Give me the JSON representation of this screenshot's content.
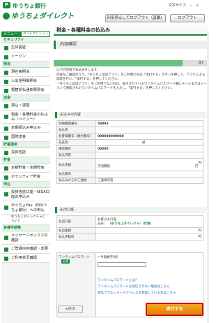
{
  "header": {
    "logo_mark": "P",
    "bank_name": "ゆうちょ銀行",
    "service_name": "ゆうちょダイレクト",
    "text_size_label": "文字サイズ",
    "size_minus": "－",
    "size_plus": "＋",
    "stop_logout_label": "利用停止してログアウト（盗難）",
    "logout_label": "ログアウト"
  },
  "sidebar": {
    "menu_label": "メニュー",
    "top_label": "ダイレクトトップ",
    "sections": [
      {
        "label": "セキュリティ",
        "items": [
          {
            "label": "生体認証"
          },
          {
            "label": "トークン"
          }
        ]
      },
      {
        "label": "照会",
        "items": [
          {
            "label": "現在高照会"
          },
          {
            "label": "入出金明細照会"
          },
          {
            "label": "振替受払通知票照会"
          }
        ]
      },
      {
        "label": "送金",
        "items": [
          {
            "label": "振込・振替"
          },
          {
            "label": "税金・各種料金の払込み（ペイジー）"
          },
          {
            "label": "定期振込み申込み"
          },
          {
            "label": "国際送金"
          }
        ]
      },
      {
        "label": "貯蓄運用",
        "items": [
          {
            "label": "投資信託"
          }
        ]
      },
      {
        "label": "貯金",
        "items": [
          {
            "label": "定額貯金・定期貯金"
          },
          {
            "label": "ボランティア貯金"
          }
        ]
      },
      {
        "label": "申込",
        "items": [
          {
            "label": "投資信託口座・NISA口座の申込み"
          },
          {
            "label": "ゆうちょPay（旧ゆうちょ銀行）への申込"
          }
        ]
      },
      {
        "label": "各種手続等",
        "items": [
          {
            "label": "メッセージボックスの確認"
          },
          {
            "label": "ご登録内容確認・変更"
          },
          {
            "label": "ご利用状況確認"
          }
        ]
      }
    ],
    "note_text": "ゆうちょダイレクト+について"
  },
  "main": {
    "title": "税金・各種料金の払込み",
    "subtitle": "内容確認",
    "step_label": "次7",
    "desc_lines": [
      "以下の内容で払込みをします。",
      "内容をご確認のうえ、「ゆうちょ認証アプリ」をご利用の方は「実行する」ボタンを押して、アプリによる認証を行い、「実行する」を押してください。",
      "「ゆうちょ認証アプリ」をご利用でない方は、表示されているワンタイムパスワード欄にメールまたはトークンで通知されたワンタイムパスワードを入力し、「実行する」を押してください。"
    ],
    "payment_section": "払込みの内容",
    "payment_rows": [
      {
        "label": "収納機関番号",
        "value": "58093"
      },
      {
        "label": "払込先",
        "value": ""
      },
      {
        "label": "お客様番号（納付番号）",
        "value": "000000000000"
      },
      {
        "label": "氏名等",
        "value": "様"
      },
      {
        "label": "確認番号",
        "value": "00000"
      },
      {
        "label": "払込内容",
        "value": ""
      },
      {
        "label": "払込金額",
        "value": "円"
      },
      {
        "label": "払込期日",
        "value": ""
      },
      {
        "label": "払込みからのご連絡",
        "value": "ご連絡内容"
      }
    ],
    "fee_label": "内消費税",
    "fee_value": "円",
    "account_section": "払出口座",
    "account_rows": [
      {
        "label": "払出口座",
        "line1": "お客さま口座",
        "line2": "記号：",
        "line3": "（ゆうちょダイレクト）（代表）"
      },
      {
        "label": "払出金額",
        "value": "円"
      },
      {
        "label": "払込手数料",
        "value": "円"
      }
    ],
    "otp": {
      "label": "ワンタイムパスワード",
      "required": "必須",
      "hint": "半角数字6桁",
      "links": [
        "ワンタイムパスワードとは？",
        "ワンタイムパスワードを受信できない場合はこちら",
        "受信できないメールアドレスを登録している方はこちら"
      ]
    },
    "back_label": "戻る",
    "execute_label": "実行する"
  }
}
